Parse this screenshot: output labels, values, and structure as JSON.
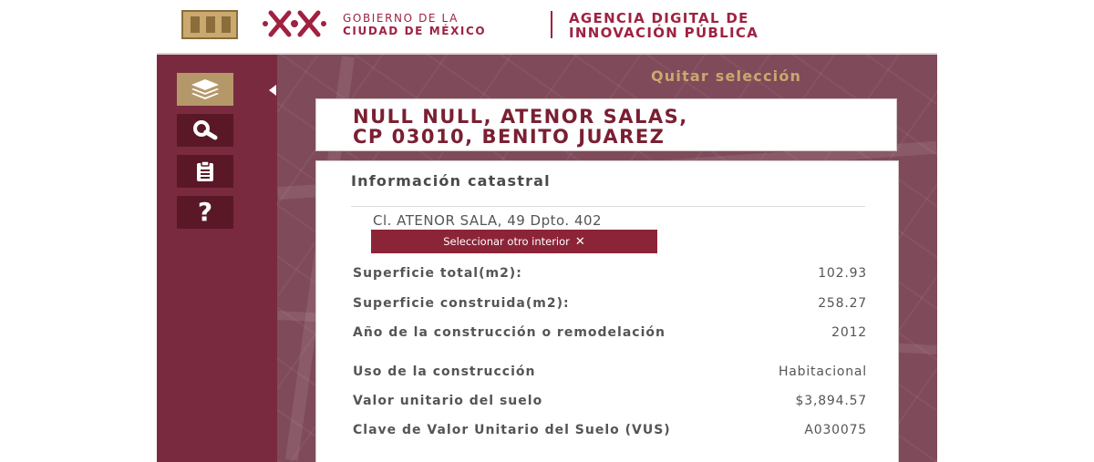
{
  "header": {
    "gob_line1": "GOBIERNO DE LA",
    "gob_line2": "CIUDAD DE MÉXICO",
    "agency_line1": "AGENCIA DIGITAL DE",
    "agency_line2": "INNOVACIÓN PÚBLICA"
  },
  "colors": {
    "brand": "#9f2241",
    "sidebar": "#7a2a3e",
    "button_dark": "#5a1826",
    "button_active": "#b5986a",
    "accent_gold": "#c9a96e"
  },
  "sidebar": {
    "tools": [
      {
        "icon": "layers-icon",
        "active": true
      },
      {
        "icon": "search-icon",
        "active": false
      },
      {
        "icon": "clipboard-icon",
        "active": false
      },
      {
        "icon": "question-icon",
        "active": false
      }
    ]
  },
  "map": {
    "clear_selection": "Quitar selección"
  },
  "address": {
    "line1": "NULL NULL, ATENOR SALAS,",
    "line2": "CP 03010, BENITO JUAREZ"
  },
  "info": {
    "title": "Información catastral",
    "unit_address": "Cl. ATENOR SALA, 49 Dpto. 402",
    "select_other_label": "Seleccionar otro interior",
    "rows": [
      {
        "label": "Superficie total(m2):",
        "value": "102.93"
      },
      {
        "label": "Superficie construida(m2):",
        "value": "258.27"
      },
      {
        "label": "Año de la construcción o remodelación",
        "value": "2012"
      },
      {
        "label": "Uso de la construcción",
        "value": "Habitacional"
      },
      {
        "label": "Valor unitario del suelo",
        "value": "$3,894.57"
      },
      {
        "label": "Clave de Valor Unitario del Suelo (VUS)",
        "value": "A030075"
      }
    ]
  }
}
